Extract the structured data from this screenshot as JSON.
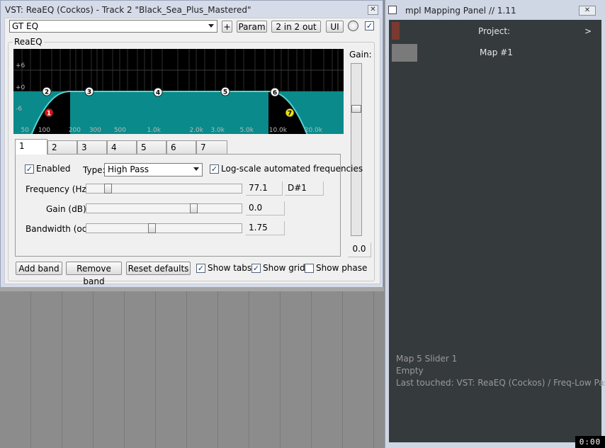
{
  "vst": {
    "title": "VST: ReaEQ (Cockos) - Track 2 \"Black_Sea_Plus_Mastered\"",
    "close": "✕",
    "preset": "GT EQ",
    "add_label": "+",
    "param_label": "Param",
    "io_label": "2 in 2 out",
    "ui_label": "UI",
    "bypass_checked": "✓",
    "group_label": "ReaEQ",
    "gain_label": "Gain:",
    "gain_value": "0.0",
    "gain_level": 0.75
  },
  "graph": {
    "db_labels": [
      "+6",
      "+0",
      "-6"
    ],
    "freq_labels": [
      "50",
      "100",
      "200",
      "300",
      "500",
      "1.0k",
      "2.0k",
      "3.0k",
      "5.0k",
      "10.0k",
      "20.0k"
    ],
    "nodes": [
      {
        "label": "1",
        "color": "#e01010"
      },
      {
        "label": "2",
        "color": "#ffffff"
      },
      {
        "label": "3",
        "color": "#ffffff"
      },
      {
        "label": "4",
        "color": "#ffffff"
      },
      {
        "label": "5",
        "color": "#ffffff"
      },
      {
        "label": "6",
        "color": "#ffffff"
      },
      {
        "label": "7",
        "color": "#f0e010"
      }
    ],
    "curve_color": "#5ad0d0",
    "fill_color": "#0a8a8a"
  },
  "tabs": [
    "1",
    "2",
    "3",
    "4",
    "5",
    "6",
    "7"
  ],
  "band": {
    "enabled_label": "Enabled",
    "enabled_check": "✓",
    "type_label": "Type:",
    "type_value": "High Pass",
    "logscale_label": "Log-scale automated frequencies",
    "logscale_check": "✓",
    "frequency_label": "Frequency (Hz):",
    "frequency_value": "77.1",
    "frequency_note": "D#1",
    "frequency_level": 0.12,
    "gain_label": "Gain (dB):",
    "gain_value": "0.0",
    "gain_level": 0.7,
    "bandwidth_label": "Bandwidth (oct):",
    "bandwidth_value": "1.75",
    "bandwidth_level": 0.42
  },
  "bottom": {
    "add_band": "Add band",
    "remove_band": "Remove band",
    "reset_defaults": "Reset defaults",
    "show_tabs": "Show tabs",
    "show_tabs_check": "✓",
    "show_grid": "Show grid",
    "show_grid_check": "✓",
    "show_phase": "Show phase",
    "show_phase_check": ""
  },
  "map": {
    "title": "mpl Mapping Panel // 1.11",
    "close": "✕",
    "project_label": "Project:",
    "project_arrow": ">",
    "map_label": "Map #1",
    "project_color": "#7a3a30",
    "map_color": "#7a7a7a",
    "footer": [
      "Map 5 Slider 1",
      "Empty",
      "Last touched: VST: ReaEQ (Cockos) / Freq-Low Pass"
    ]
  },
  "clock": "0:00"
}
